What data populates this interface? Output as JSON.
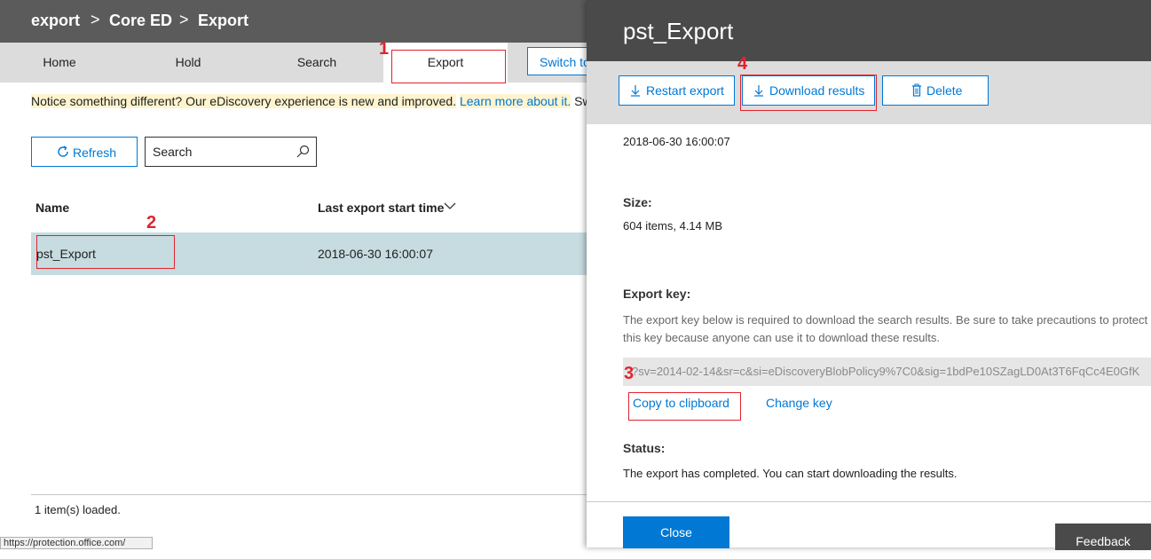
{
  "breadcrumb": {
    "items": [
      "export",
      "Core ED",
      "Export"
    ],
    "separator": ">"
  },
  "tabs": [
    {
      "label": "Home"
    },
    {
      "label": "Hold"
    },
    {
      "label": "Search"
    },
    {
      "label": "Export",
      "active": true
    }
  ],
  "switch_button": {
    "label": "Switch to"
  },
  "notice": {
    "text": "Notice something different? Our eDiscovery experience is new and improved.",
    "link": "Learn more about it.",
    "trailing": "Sw"
  },
  "toolbar": {
    "refresh_label": "Refresh",
    "search_placeholder": "Search"
  },
  "table": {
    "columns": [
      "Name",
      "Last export start time"
    ],
    "rows": [
      {
        "name": "pst_Export",
        "last_export_start_time": "2018-06-30 16:00:07"
      }
    ],
    "status": "1 item(s) loaded."
  },
  "status_url": "https://protection.office.com/",
  "panel": {
    "title": "pst_Export",
    "buttons": {
      "restart": "Restart export",
      "download": "Download results",
      "delete": "Delete"
    },
    "start_time": "2018-06-30 16:00:07",
    "size_label": "Size:",
    "size_value": "604 items, 4.14 MB",
    "export_key_label": "Export key:",
    "export_key_description": "The export key below is required to download the search results. Be sure to take precautions to protect this key because anyone can use it to download these results.",
    "export_key_value": "?sv=2014-02-14&sr=c&si=eDiscoveryBlobPolicy9%7C0&sig=1bdPe10SZagLD0At3T6FqCc4E0GfK",
    "copy_label": "Copy to clipboard",
    "change_key_label": "Change key",
    "status_label": "Status:",
    "status_value": "The export has completed. You can start downloading the results.",
    "close_label": "Close"
  },
  "feedback_label": "Feedback",
  "annotations": {
    "step1": "1",
    "step2": "2",
    "step3": "3",
    "step4": "4",
    "color": "#e0242e"
  },
  "colors": {
    "accent": "#0078d4",
    "header": "#4a4a4a",
    "selected_row": "#c7dce0",
    "notice_bg": "#fff4ce"
  }
}
